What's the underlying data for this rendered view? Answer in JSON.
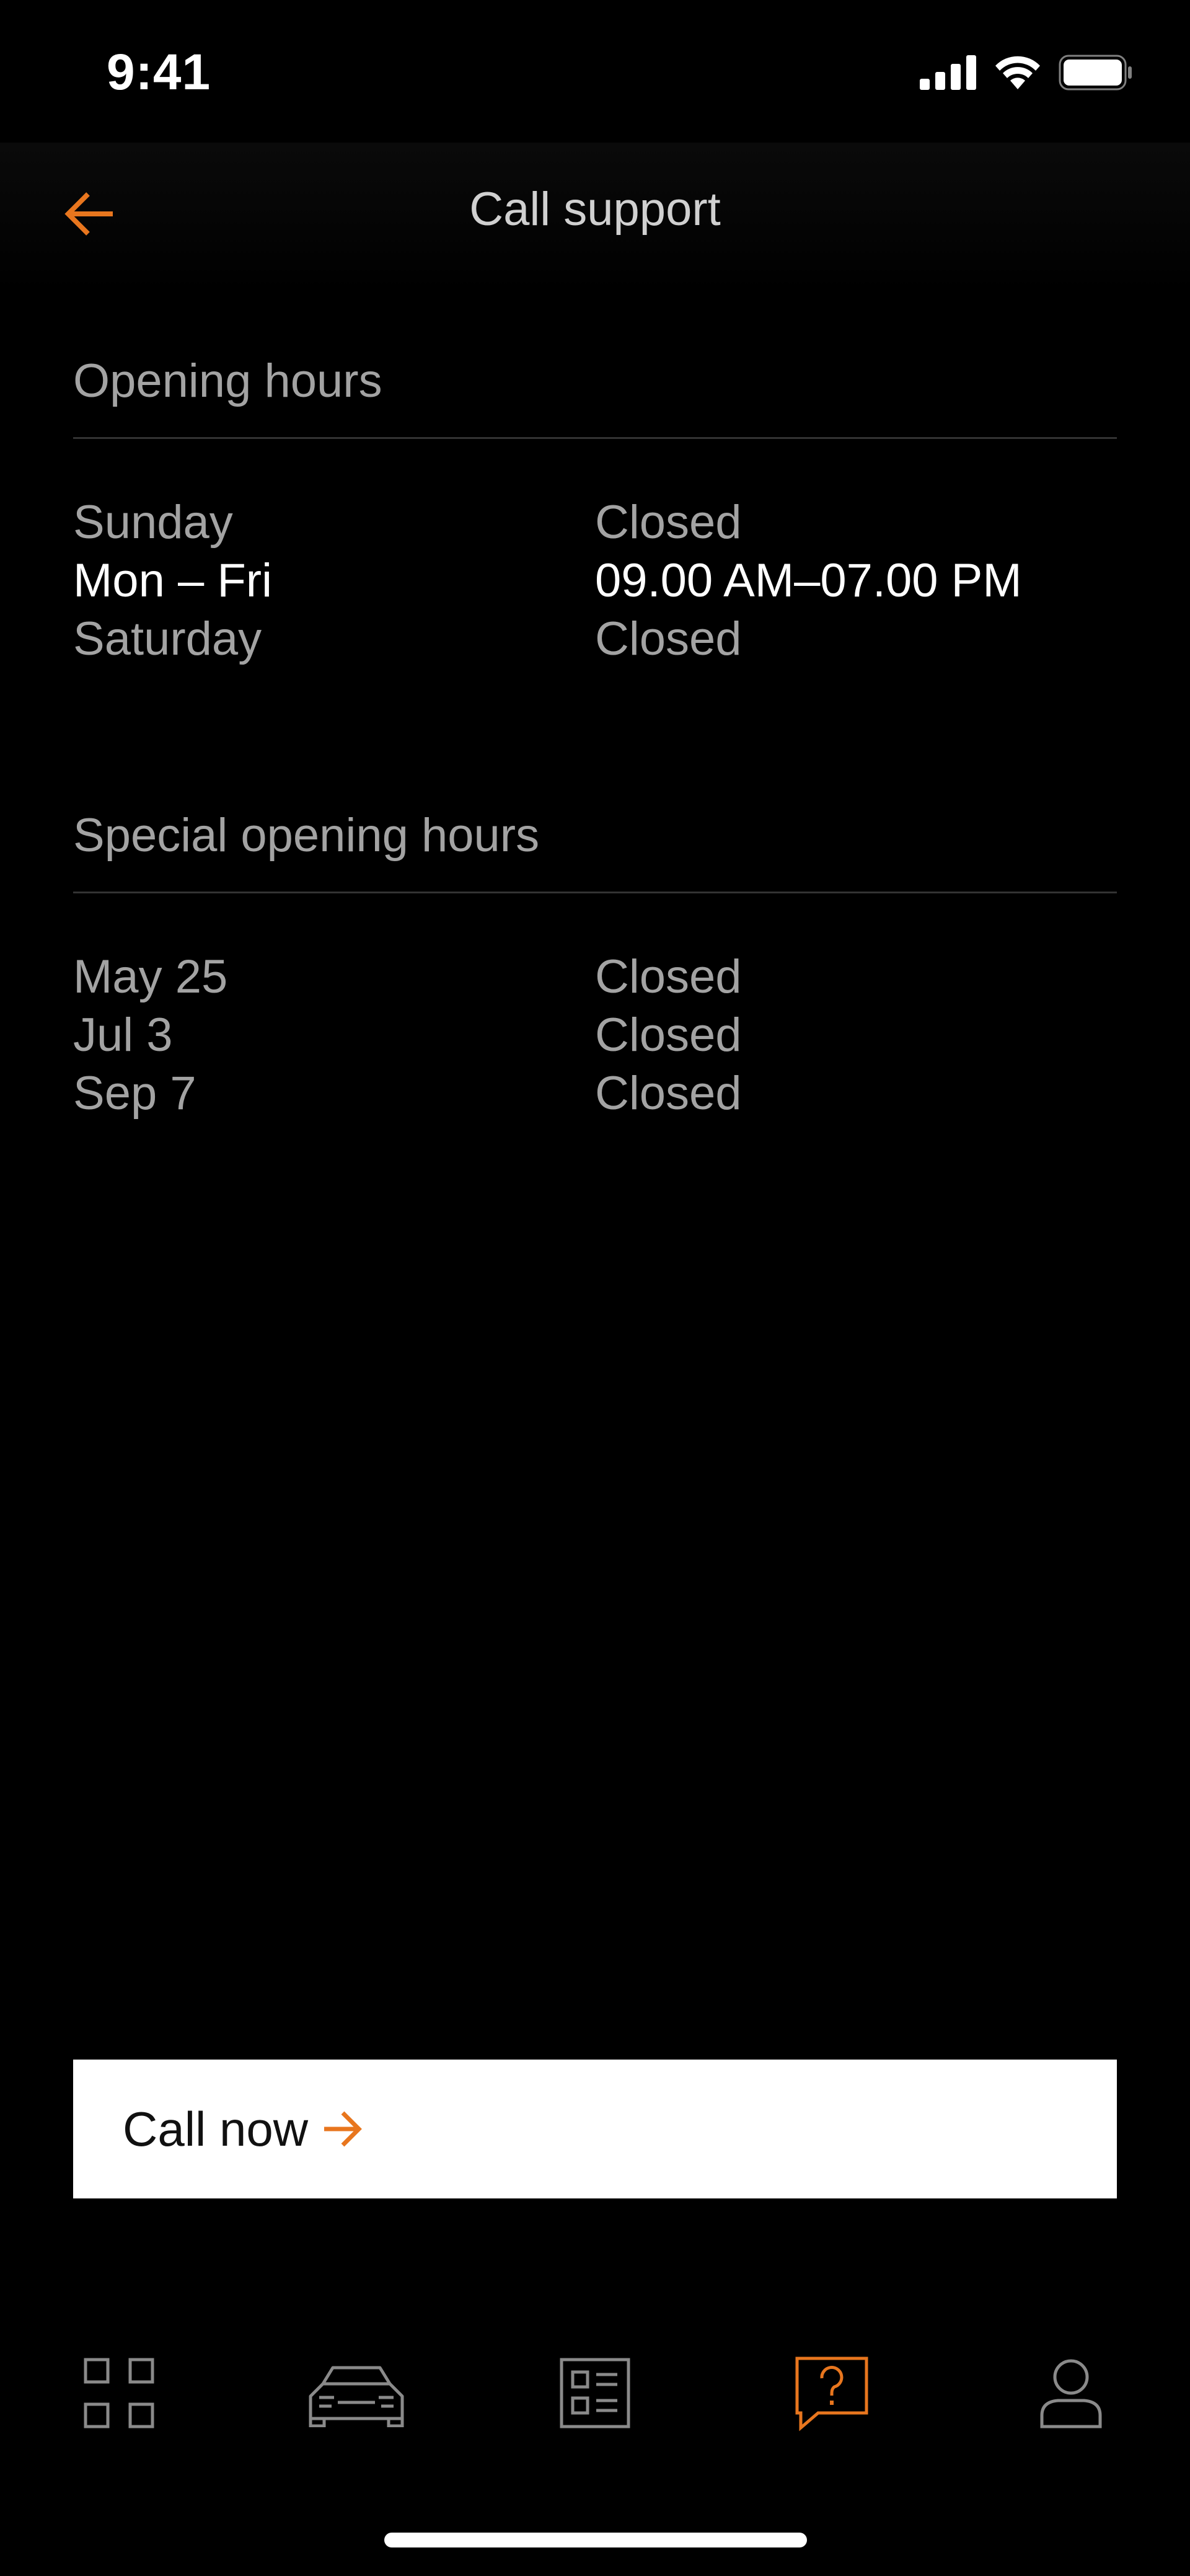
{
  "status_bar": {
    "time": "9:41",
    "icons": [
      "cellular-signal-icon",
      "wifi-icon",
      "battery-icon"
    ]
  },
  "header": {
    "title": "Call support",
    "back_icon": "arrow-left-icon"
  },
  "opening_hours": {
    "title": "Opening hours",
    "rows": [
      {
        "day": "Sunday",
        "hours": "Closed",
        "active": false
      },
      {
        "day": "Mon – Fri",
        "hours": "09.00 AM–07.00 PM",
        "active": true
      },
      {
        "day": "Saturday",
        "hours": "Closed",
        "active": false
      }
    ]
  },
  "special_hours": {
    "title": "Special opening hours",
    "rows": [
      {
        "day": "May 25",
        "hours": "Closed"
      },
      {
        "day": "Jul 3",
        "hours": "Closed"
      },
      {
        "day": "Sep 7",
        "hours": "Closed"
      }
    ]
  },
  "call_button": {
    "label": "Call now",
    "icon": "arrow-right-icon"
  },
  "tab_bar": {
    "items": [
      {
        "icon": "dashboard-grid-icon",
        "active": false
      },
      {
        "icon": "car-icon",
        "active": false
      },
      {
        "icon": "list-document-icon",
        "active": false
      },
      {
        "icon": "help-chat-icon",
        "active": true
      },
      {
        "icon": "profile-icon",
        "active": false
      }
    ]
  },
  "colors": {
    "accent": "#E8761E",
    "background": "#000000",
    "text_primary": "#FFFFFF",
    "text_secondary": "#A3A3A3"
  }
}
